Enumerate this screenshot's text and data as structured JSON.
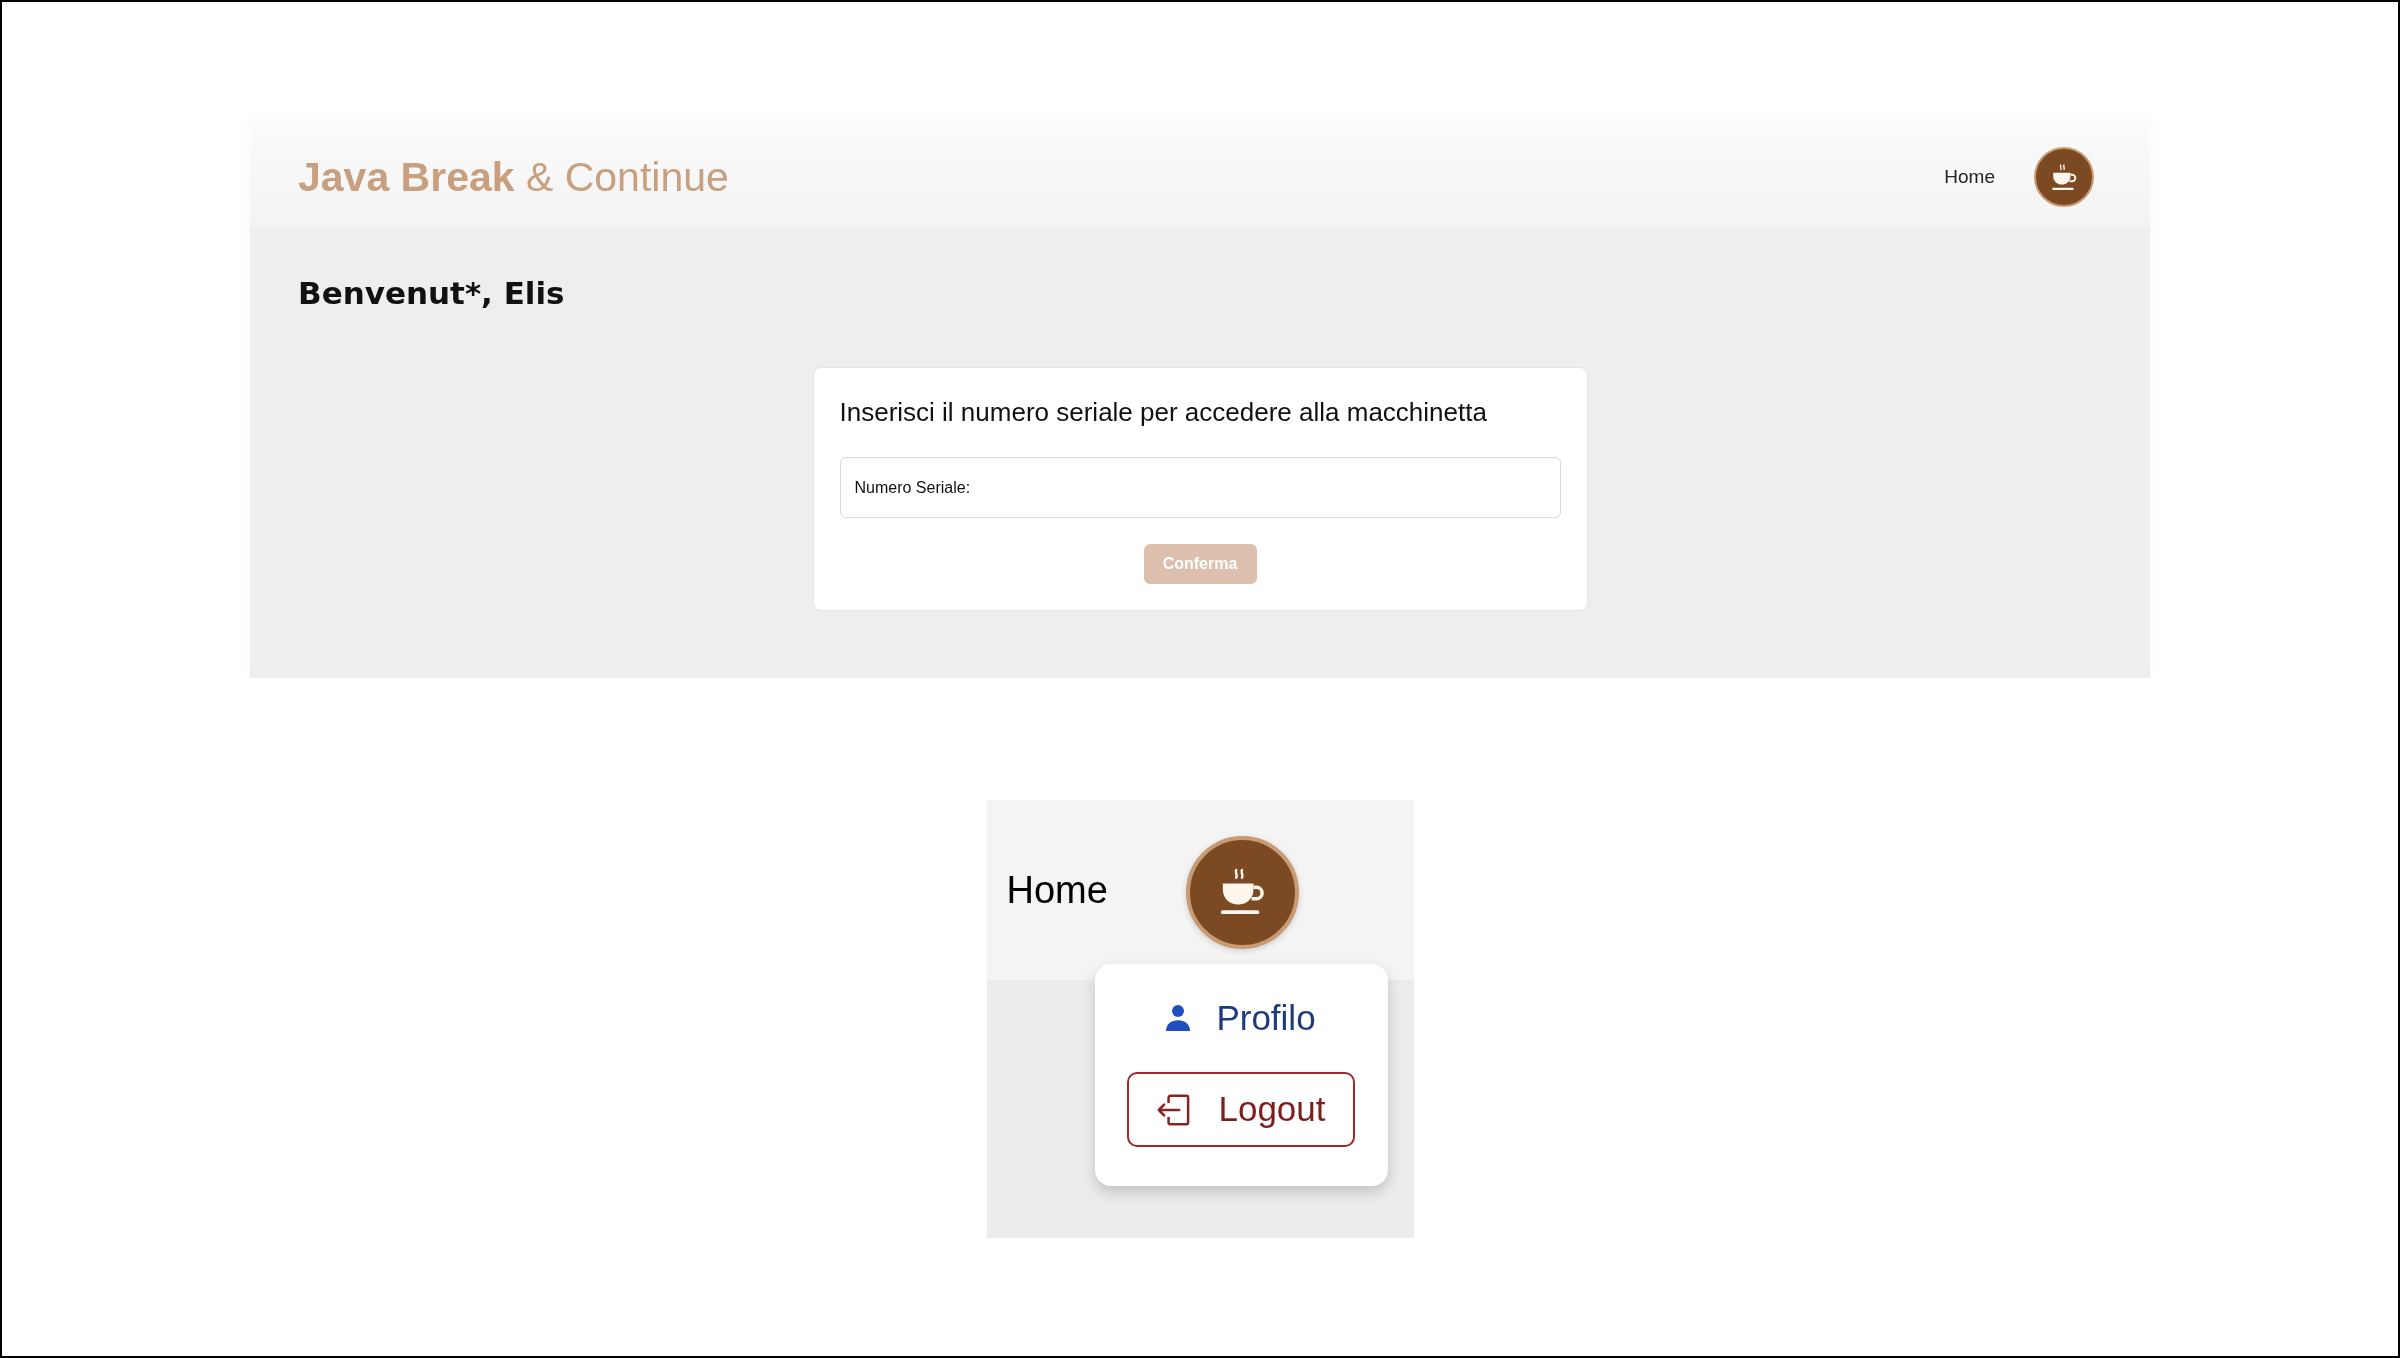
{
  "header": {
    "logo": "**Java Break** & Continue",
    "nav_link": "Home"
  },
  "welcome": "Benvenut*, Elis",
  "serial_card": {
    "title": "Inserisci il numero seriale per accedere alla macchinetta",
    "serial_field": {
      "placeholder": "Numero Seriale:"
    },
    "confirm_button": {
      "label": "Conferma",
      "disabled": true
    }
  },
  "menu_closeup": {
    "nav_link": "Home",
    "dropdown": [
      {
        "kind": "link",
        "label": "Profilo"
      },
      {
        "kind": "button",
        "label": "Logout"
      }
    ]
  }
}
